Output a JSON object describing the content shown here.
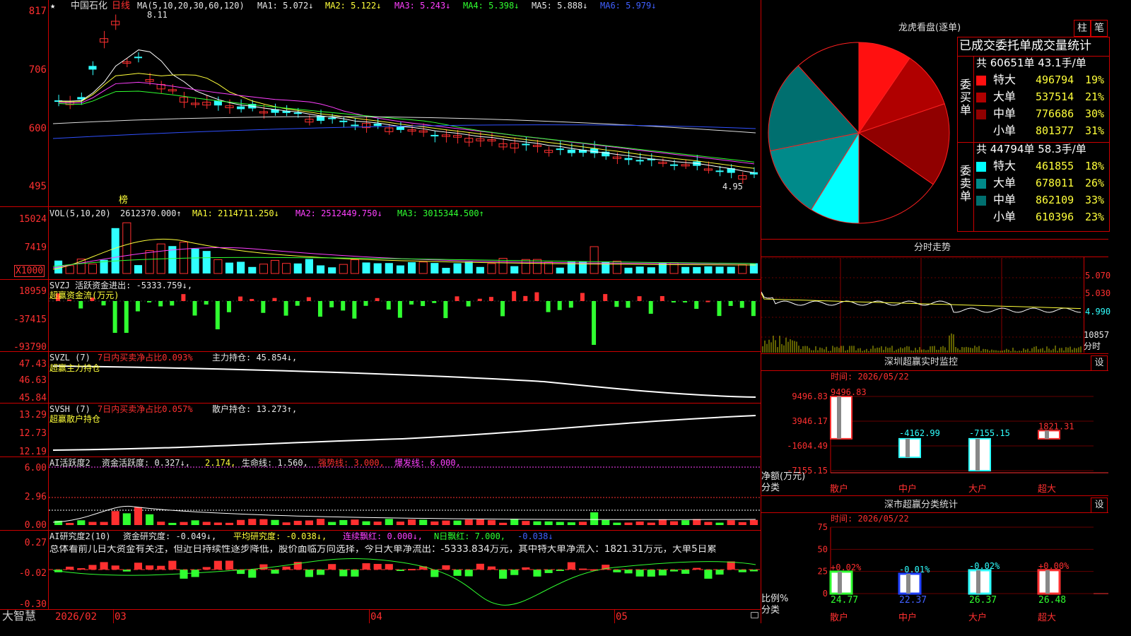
{
  "stock": {
    "name": "中国石化",
    "period": "日线",
    "star": "★"
  },
  "main": {
    "ma_label": "MA(5,10,20,30,60,120)",
    "ma1": "MA1: 5.072↓",
    "ma2": "MA2: 5.122↓",
    "ma3": "MA3: 5.243↓",
    "ma4": "MA4: 5.398↓",
    "ma5": "MA5: 5.888↓",
    "ma6": "MA6: 5.979↓",
    "high_label": "8.11",
    "low_label": "4.95",
    "bang": "榜",
    "axis": [
      "817",
      "706",
      "600",
      "495"
    ]
  },
  "vol": {
    "label": "VOL(5,10,20)",
    "v": "2612370.000↑",
    "ma1": "MA1: 2114711.250↓",
    "ma2": "MA2: 2512449.750↓",
    "ma3": "MA3: 3015344.500↑",
    "axis": [
      "15024",
      "7419"
    ],
    "unit": "X1000"
  },
  "svzj": {
    "label": "SVZJ  活跃资金进出: -5333.759↓,",
    "sub": "超赢资金流(万元)",
    "axis": [
      "18959",
      "-37415",
      "-93790"
    ]
  },
  "svzl": {
    "label": "SVZL (7)",
    "net": "7日内买卖净占比0.093%",
    "hold": "主力持仓: 45.854↓,",
    "sub": "超赢主力持仓",
    "axis": [
      "47.43",
      "46.63",
      "45.84"
    ]
  },
  "svsh": {
    "label": "SVSH (7)",
    "net": "7日内买卖净占比0.057%",
    "hold": "散户持仓: 13.273↑,",
    "sub": "超赢散户持仓",
    "axis": [
      "13.29",
      "12.73",
      "12.19"
    ]
  },
  "ai1": {
    "label": "AI活跃度2",
    "a": "资金活跃度: 0.327↓,",
    "b": "2.174,",
    "c": "生命线: 1.560,",
    "d": "强势线: 3.000,",
    "e": "爆发线: 6.000,",
    "axis": [
      "6.00",
      "2.96",
      "0.00"
    ]
  },
  "ai2": {
    "label": "AI研究度2(10)",
    "a": "资金研究度: -0.049↓,",
    "b": "平均研究度: -0.038↓,",
    "c": "连续飘红: 0.000↓,",
    "d": "N日飘红: 7.000,",
    "e": "-0.038↓",
    "summary": "总体看前几日大资金有关注，但近日持续性逐步降低，股价面临方向选择，今日大单净流出：-5333.834万元，其中特大单净流入：1821.31万元，大单5日累",
    "axis": [
      "0.27",
      "-0.02",
      "-0.30"
    ]
  },
  "xaxis": {
    "brand": "大智慧",
    "d1": "2026/02",
    "d2": "03",
    "d3": "04",
    "d4": "05"
  },
  "longhu": {
    "title": "龙虎看盘(逐单)",
    "btn1": "柱",
    "btn2": "笔",
    "header": "已成交委托单成交量统计",
    "buy_label": "委买单",
    "buy_total": "共 60651单 43.1手/单",
    "buy": [
      {
        "k": "特大",
        "v": "496794",
        "p": "19%",
        "c": "#ff1010"
      },
      {
        "k": "大单",
        "v": "537514",
        "p": "21%",
        "c": "#b00000"
      },
      {
        "k": "中单",
        "v": "776686",
        "p": "30%",
        "c": "#900000"
      },
      {
        "k": "小单",
        "v": "801377",
        "p": "31%",
        "c": "#000000"
      }
    ],
    "sell_label": "委卖单",
    "sell_total": "共 44794单 58.3手/单",
    "sell": [
      {
        "k": "特大",
        "v": "461855",
        "p": "18%",
        "c": "#00ffff"
      },
      {
        "k": "大单",
        "v": "678011",
        "p": "26%",
        "c": "#008a8a"
      },
      {
        "k": "中单",
        "v": "862109",
        "p": "33%",
        "c": "#006f6f"
      },
      {
        "k": "小单",
        "v": "610396",
        "p": "23%",
        "c": "#000000"
      }
    ]
  },
  "intraday": {
    "title": "分时走势",
    "p1": "5.070",
    "p2": "5.030",
    "p3": "4.990",
    "vol": "10857",
    "unit": "分时"
  },
  "monitor": {
    "title": "深圳超赢实时监控",
    "btn": "设",
    "time": "时间: 2026/05/22",
    "axis": [
      "9496.83",
      "3946.17",
      "-1604.49",
      "-7155.15"
    ],
    "ylabel": "净额(万元)",
    "xlabel": "分类",
    "bars": [
      {
        "k": "散户",
        "v": "9496.83"
      },
      {
        "k": "中户",
        "v": "-4162.99"
      },
      {
        "k": "大户",
        "v": "-7155.15"
      },
      {
        "k": "超大",
        "v": "1821.31"
      }
    ]
  },
  "classify": {
    "title": "深市超赢分类统计",
    "btn": "设",
    "time": "时间: 2026/05/22",
    "axis": [
      "75",
      "50",
      "25",
      "0"
    ],
    "ylabel": "比例%",
    "xlabel": "分类",
    "bars": [
      {
        "k": "散户",
        "top": "+0.02%",
        "v": "24.77"
      },
      {
        "k": "中户",
        "top": "-0.01%",
        "v": "22.37"
      },
      {
        "k": "大户",
        "top": "-0.02%",
        "v": "26.37"
      },
      {
        "k": "超大",
        "top": "+0.00%",
        "v": "26.48"
      }
    ]
  },
  "chart_data": [
    {
      "type": "pie",
      "title": "龙虎看盘(逐单)",
      "series": [
        {
          "name": "委买单",
          "values": [
            496794,
            537514,
            776686,
            801377
          ]
        },
        {
          "name": "委卖单",
          "values": [
            461855,
            678011,
            862109,
            610396
          ]
        }
      ]
    },
    {
      "type": "bar",
      "title": "深圳超赢实时监控",
      "categories": [
        "散户",
        "中户",
        "大户",
        "超大"
      ],
      "values": [
        9496.83,
        -4162.99,
        -7155.15,
        1821.31
      ],
      "ylabel": "净额(万元)",
      "xlabel": "分类",
      "ylim": [
        -7155.15,
        9496.83
      ]
    },
    {
      "type": "bar",
      "title": "深市超赢分类统计",
      "categories": [
        "散户",
        "中户",
        "大户",
        "超大"
      ],
      "values": [
        24.77,
        22.37,
        26.37,
        26.48
      ],
      "ylabel": "比例%",
      "xlabel": "分类",
      "ylim": [
        0,
        75
      ]
    }
  ]
}
